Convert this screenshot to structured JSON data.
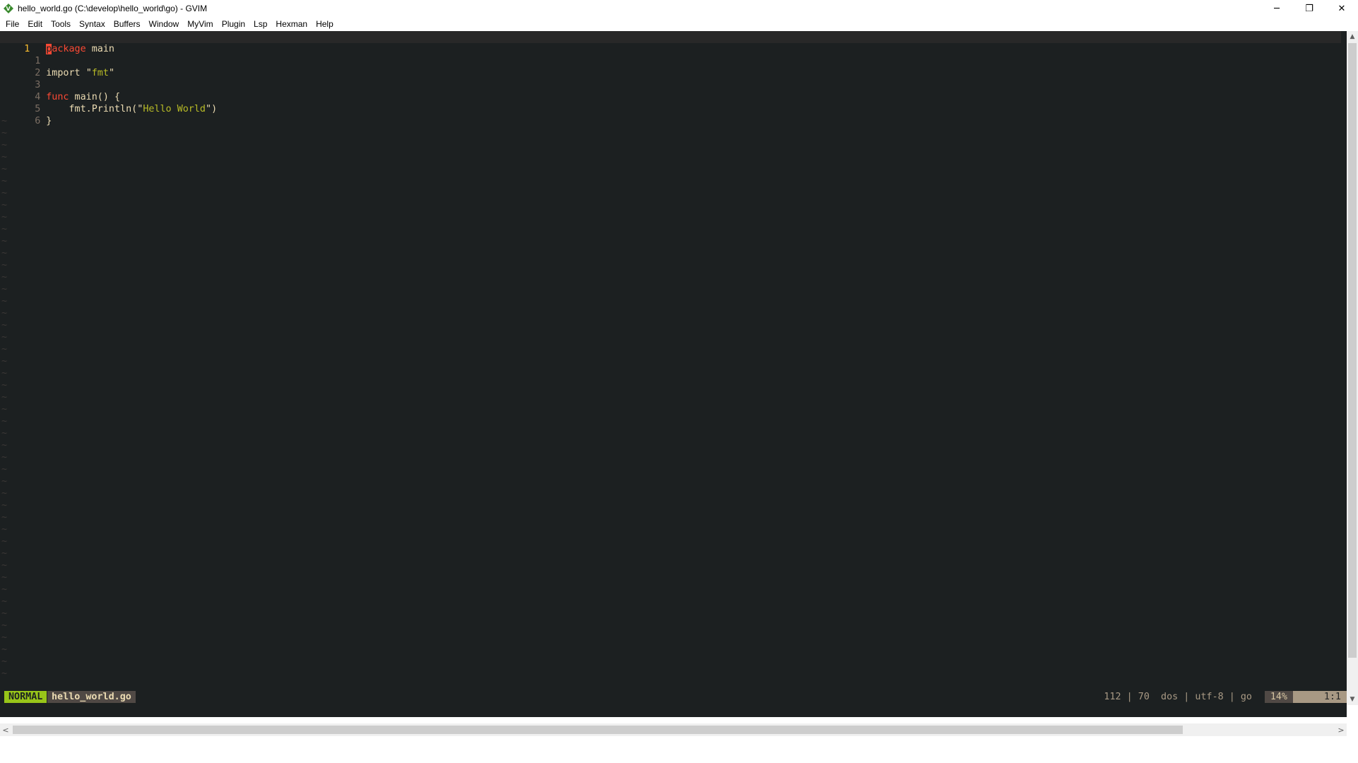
{
  "window": {
    "title": "hello_world.go (C:\\develop\\hello_world\\go) - GVIM",
    "app_icon": "gvim-icon",
    "controls": {
      "minimize": "─",
      "restore": "❐",
      "close": "✕"
    }
  },
  "menu": {
    "items": [
      "File",
      "Edit",
      "Tools",
      "Syntax",
      "Buffers",
      "Window",
      "MyVim",
      "Plugin",
      "Lsp",
      "Hexman",
      "Help"
    ]
  },
  "editor": {
    "lines": [
      {
        "num": "1",
        "text": "package main"
      },
      {
        "num": "1",
        "text": ""
      },
      {
        "num": "2",
        "text": "import \"fmt\""
      },
      {
        "num": "3",
        "text": ""
      },
      {
        "num": "4",
        "text": "func main() {"
      },
      {
        "num": "5",
        "text": "    fmt.Println(\"Hello World\")"
      },
      {
        "num": "6",
        "text": "}"
      }
    ],
    "tilde": "~",
    "colors": {
      "background": "#1c2021",
      "keyword": "#fb4934",
      "string": "#b8bb26",
      "foreground": "#ebdbb2"
    }
  },
  "statusline": {
    "mode": "NORMAL",
    "filename": "hello_world.go",
    "info": "112 | 70  dos | utf-8 | go",
    "percent": "14%",
    "position": "1:1",
    "mode_color": "#98c519"
  },
  "scrollbars": {
    "up_arrow": "▲",
    "down_arrow": "▼",
    "left_arrow": "<",
    "right_arrow": ">"
  }
}
